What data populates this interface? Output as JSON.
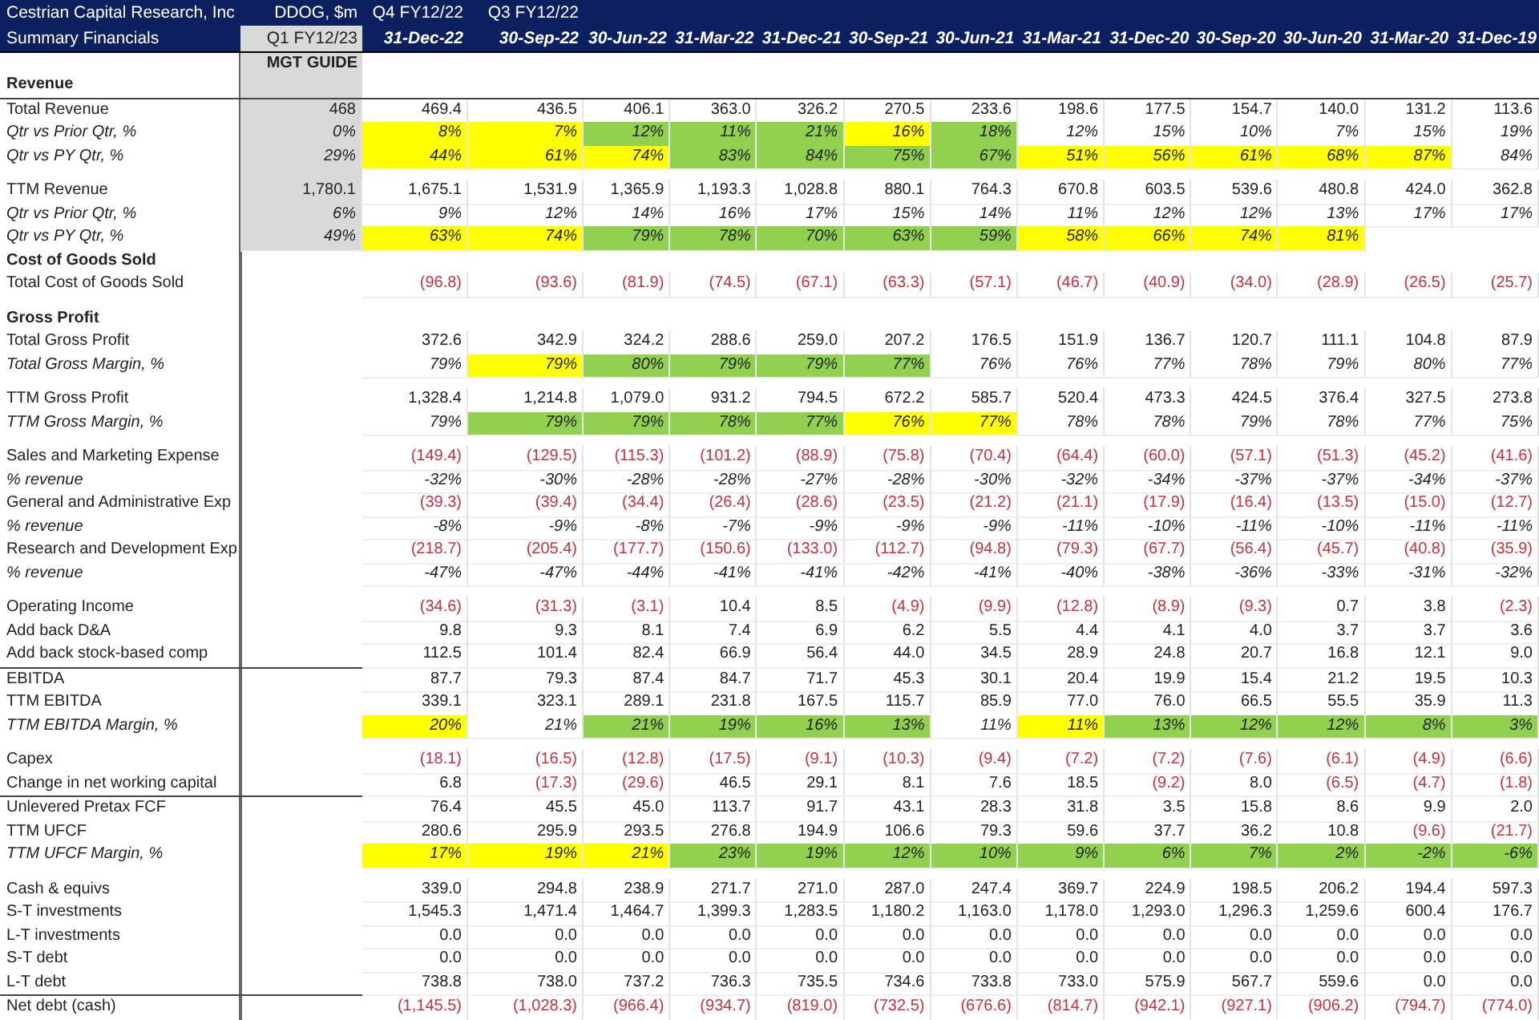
{
  "title": {
    "company": "Cestrian Capital Research, Inc",
    "subtitle": "Summary Financials"
  },
  "columns": [
    {
      "top": "DDOG, $m",
      "bottom": "Q1 FY12/23",
      "note": "MGT GUIDE",
      "shaded": true
    },
    {
      "top": "Q4 FY12/22",
      "bottom": "31-Dec-22",
      "shaded": false
    },
    {
      "top": "Q3 FY12/22",
      "bottom": "30-Sep-22",
      "shaded": false
    },
    {
      "bottom": "30-Jun-22",
      "shaded": false
    },
    {
      "bottom": "31-Mar-22",
      "shaded": false
    },
    {
      "bottom": "31-Dec-21",
      "shaded": false
    },
    {
      "bottom": "30-Sep-21",
      "shaded": false
    },
    {
      "bottom": "30-Jun-21",
      "shaded": false
    },
    {
      "bottom": "31-Mar-21",
      "shaded": false
    },
    {
      "bottom": "31-Dec-20",
      "shaded": false
    },
    {
      "bottom": "30-Sep-20",
      "shaded": false
    },
    {
      "bottom": "30-Jun-20",
      "shaded": false
    },
    {
      "bottom": "31-Mar-20",
      "shaded": false
    },
    {
      "bottom": "31-Dec-19",
      "shaded": false
    }
  ],
  "rows": [
    {
      "kind": "section",
      "label": "Revenue",
      "rule_above": false,
      "guide_shaded": true
    },
    {
      "kind": "value",
      "label": "Total Revenue",
      "rule_above": true,
      "guide_shaded": true,
      "guide": "468",
      "negative": false,
      "cells": [
        "469.4",
        "436.5",
        "406.1",
        "363.0",
        "326.2",
        "270.5",
        "233.6",
        "198.6",
        "177.5",
        "154.7",
        "140.0",
        "131.2",
        "113.6"
      ]
    },
    {
      "kind": "percent",
      "label": "Qtr vs Prior Qtr, %",
      "rule_above": false,
      "guide_shaded": true,
      "guide": "0%",
      "negative": false,
      "cells": [
        {
          "text": "8%",
          "color": "#ffff00"
        },
        {
          "text": "7%",
          "color": "#ffff00"
        },
        {
          "text": "12%",
          "color": "#92d050"
        },
        {
          "text": "11%",
          "color": "#92d050"
        },
        {
          "text": "21%",
          "color": "#92d050"
        },
        {
          "text": "16%",
          "color": "#ffff00"
        },
        {
          "text": "18%",
          "color": "#92d050"
        },
        {
          "text": "12%",
          "color": "#ffffff"
        },
        {
          "text": "15%",
          "color": "#ffffff"
        },
        {
          "text": "10%",
          "color": "#ffffff"
        },
        {
          "text": "7%",
          "color": "#ffffff"
        },
        {
          "text": "15%",
          "color": "#ffffff"
        },
        {
          "text": "19%",
          "color": "#ffffff"
        }
      ]
    },
    {
      "kind": "percent",
      "label": "Qtr vs PY Qtr, %",
      "rule_above": false,
      "guide_shaded": true,
      "guide": "29%",
      "negative": false,
      "cells": [
        {
          "text": "44%",
          "color": "#ffff00"
        },
        {
          "text": "61%",
          "color": "#ffff00"
        },
        {
          "text": "74%",
          "color": "#ffff00"
        },
        {
          "text": "83%",
          "color": "#92d050"
        },
        {
          "text": "84%",
          "color": "#92d050"
        },
        {
          "text": "75%",
          "color": "#92d050"
        },
        {
          "text": "67%",
          "color": "#92d050"
        },
        {
          "text": "51%",
          "color": "#ffff00"
        },
        {
          "text": "56%",
          "color": "#ffff00"
        },
        {
          "text": "61%",
          "color": "#ffff00"
        },
        {
          "text": "68%",
          "color": "#ffff00"
        },
        {
          "text": "87%",
          "color": "#ffff00"
        },
        {
          "text": "84%",
          "color": "#ffffff"
        }
      ]
    },
    {
      "kind": "spacer",
      "rule_above": false,
      "guide_shaded": true
    },
    {
      "kind": "value",
      "label": "TTM Revenue",
      "rule_above": false,
      "guide_shaded": true,
      "guide": "1,780.1",
      "negative": false,
      "cells": [
        "1,675.1",
        "1,531.9",
        "1,365.9",
        "1,193.3",
        "1,028.8",
        "880.1",
        "764.3",
        "670.8",
        "603.5",
        "539.6",
        "480.8",
        "424.0",
        "362.8"
      ]
    },
    {
      "kind": "percent",
      "label": "Qtr vs Prior Qtr, %",
      "rule_above": false,
      "guide_shaded": true,
      "guide": "6%",
      "negative": false,
      "cells": [
        "9%",
        "12%",
        "14%",
        "16%",
        "17%",
        "15%",
        "14%",
        "11%",
        "12%",
        "12%",
        "13%",
        "17%",
        "17%"
      ]
    },
    {
      "kind": "percent",
      "label": "Qtr vs PY Qtr, %",
      "rule_above": false,
      "guide_shaded": true,
      "guide": "49%",
      "negative": false,
      "cells": [
        {
          "text": "63%",
          "color": "#ffff00"
        },
        {
          "text": "74%",
          "color": "#ffff00"
        },
        {
          "text": "79%",
          "color": "#92d050"
        },
        {
          "text": "78%",
          "color": "#92d050"
        },
        {
          "text": "70%",
          "color": "#92d050"
        },
        {
          "text": "63%",
          "color": "#92d050"
        },
        {
          "text": "59%",
          "color": "#92d050"
        },
        {
          "text": "58%",
          "color": "#ffff00"
        },
        {
          "text": "66%",
          "color": "#ffff00"
        },
        {
          "text": "74%",
          "color": "#ffff00"
        },
        {
          "text": "81%",
          "color": "#ffff00"
        }
      ]
    },
    {
      "kind": "section",
      "label": "Cost of Goods Sold",
      "rule_above": false,
      "guide_shaded": false
    },
    {
      "kind": "value",
      "label": "Total Cost of Goods Sold",
      "rule_above": false,
      "guide_shaded": false,
      "negative": true,
      "cells": [
        "(96.8)",
        "(93.6)",
        "(81.9)",
        "(74.5)",
        "(67.1)",
        "(63.3)",
        "(57.1)",
        "(46.7)",
        "(40.9)",
        "(34.0)",
        "(28.9)",
        "(26.5)",
        "(25.7)"
      ]
    },
    {
      "kind": "spacer",
      "rule_above": false,
      "guide_shaded": false
    },
    {
      "kind": "section",
      "label": "Gross Profit",
      "rule_above": false,
      "guide_shaded": false
    },
    {
      "kind": "value",
      "label": "Total Gross Profit",
      "rule_above": false,
      "guide_shaded": false,
      "negative": false,
      "cells": [
        "372.6",
        "342.9",
        "324.2",
        "288.6",
        "259.0",
        "207.2",
        "176.5",
        "151.9",
        "136.7",
        "120.7",
        "111.1",
        "104.8",
        "87.9"
      ]
    },
    {
      "kind": "percent",
      "label": "Total Gross Margin, %",
      "rule_above": false,
      "guide_shaded": false,
      "negative": false,
      "cells": [
        {
          "text": "79%",
          "color": "#ffffff"
        },
        {
          "text": "79%",
          "color": "#ffff00"
        },
        {
          "text": "80%",
          "color": "#92d050"
        },
        {
          "text": "79%",
          "color": "#92d050"
        },
        {
          "text": "79%",
          "color": "#92d050"
        },
        {
          "text": "77%",
          "color": "#92d050"
        },
        {
          "text": "76%",
          "color": "#ffffff"
        },
        {
          "text": "76%",
          "color": "#ffffff"
        },
        {
          "text": "77%",
          "color": "#ffffff"
        },
        {
          "text": "78%",
          "color": "#ffffff"
        },
        {
          "text": "79%",
          "color": "#ffffff"
        },
        {
          "text": "80%",
          "color": "#ffffff"
        },
        {
          "text": "77%",
          "color": "#ffffff"
        }
      ]
    },
    {
      "kind": "spacer",
      "rule_above": false,
      "guide_shaded": false
    },
    {
      "kind": "value",
      "label": "TTM Gross Profit",
      "rule_above": false,
      "guide_shaded": false,
      "negative": false,
      "cells": [
        "1,328.4",
        "1,214.8",
        "1,079.0",
        "931.2",
        "794.5",
        "672.2",
        "585.7",
        "520.4",
        "473.3",
        "424.5",
        "376.4",
        "327.5",
        "273.8"
      ]
    },
    {
      "kind": "percent",
      "label": "TTM Gross Margin, %",
      "rule_above": false,
      "guide_shaded": false,
      "negative": false,
      "cells": [
        {
          "text": "79%",
          "color": "#ffffff"
        },
        {
          "text": "79%",
          "color": "#92d050"
        },
        {
          "text": "79%",
          "color": "#92d050"
        },
        {
          "text": "78%",
          "color": "#92d050"
        },
        {
          "text": "77%",
          "color": "#92d050"
        },
        {
          "text": "76%",
          "color": "#ffff00"
        },
        {
          "text": "77%",
          "color": "#ffff00"
        },
        {
          "text": "78%",
          "color": "#ffffff"
        },
        {
          "text": "78%",
          "color": "#ffffff"
        },
        {
          "text": "79%",
          "color": "#ffffff"
        },
        {
          "text": "78%",
          "color": "#ffffff"
        },
        {
          "text": "77%",
          "color": "#ffffff"
        },
        {
          "text": "75%",
          "color": "#ffffff"
        }
      ]
    },
    {
      "kind": "spacer",
      "rule_above": false,
      "guide_shaded": false
    },
    {
      "kind": "value",
      "label": "Sales and Marketing Expense",
      "rule_above": false,
      "guide_shaded": false,
      "negative": true,
      "cells": [
        "(149.4)",
        "(129.5)",
        "(115.3)",
        "(101.2)",
        "(88.9)",
        "(75.8)",
        "(70.4)",
        "(64.4)",
        "(60.0)",
        "(57.1)",
        "(51.3)",
        "(45.2)",
        "(41.6)"
      ]
    },
    {
      "kind": "percent",
      "label": "% revenue",
      "rule_above": false,
      "guide_shaded": false,
      "negative": false,
      "cells": [
        "-32%",
        "-30%",
        "-28%",
        "-28%",
        "-27%",
        "-28%",
        "-30%",
        "-32%",
        "-34%",
        "-37%",
        "-37%",
        "-34%",
        "-37%"
      ]
    },
    {
      "kind": "value",
      "label": "General and Administrative Exp",
      "rule_above": false,
      "guide_shaded": false,
      "negative": true,
      "cells": [
        "(39.3)",
        "(39.4)",
        "(34.4)",
        "(26.4)",
        "(28.6)",
        "(23.5)",
        "(21.2)",
        "(21.1)",
        "(17.9)",
        "(16.4)",
        "(13.5)",
        "(15.0)",
        "(12.7)"
      ]
    },
    {
      "kind": "percent",
      "label": "% revenue",
      "rule_above": false,
      "guide_shaded": false,
      "negative": false,
      "cells": [
        "-8%",
        "-9%",
        "-8%",
        "-7%",
        "-9%",
        "-9%",
        "-9%",
        "-11%",
        "-10%",
        "-11%",
        "-10%",
        "-11%",
        "-11%"
      ]
    },
    {
      "kind": "value",
      "label": "Research and Development Exp",
      "rule_above": false,
      "guide_shaded": false,
      "negative": true,
      "cells": [
        "(218.7)",
        "(205.4)",
        "(177.7)",
        "(150.6)",
        "(133.0)",
        "(112.7)",
        "(94.8)",
        "(79.3)",
        "(67.7)",
        "(56.4)",
        "(45.7)",
        "(40.8)",
        "(35.9)"
      ]
    },
    {
      "kind": "percent",
      "label": "% revenue",
      "rule_above": false,
      "guide_shaded": false,
      "negative": false,
      "cells": [
        "-47%",
        "-47%",
        "-44%",
        "-41%",
        "-41%",
        "-42%",
        "-41%",
        "-40%",
        "-38%",
        "-36%",
        "-33%",
        "-31%",
        "-32%"
      ]
    },
    {
      "kind": "spacer",
      "rule_above": false,
      "guide_shaded": false
    },
    {
      "kind": "value",
      "label": "Operating Income",
      "rule_above": false,
      "guide_shaded": false,
      "cells": [
        {
          "text": "(34.6)",
          "negative": true
        },
        {
          "text": "(31.3)",
          "negative": true
        },
        {
          "text": "(3.1)",
          "negative": true
        },
        {
          "text": "10.4",
          "negative": false
        },
        {
          "text": "8.5",
          "negative": false
        },
        {
          "text": "(4.9)",
          "negative": true
        },
        {
          "text": "(9.9)",
          "negative": true
        },
        {
          "text": "(12.8)",
          "negative": true
        },
        {
          "text": "(8.9)",
          "negative": true
        },
        {
          "text": "(9.3)",
          "negative": true
        },
        {
          "text": "0.7",
          "negative": false
        },
        {
          "text": "3.8",
          "negative": false
        },
        {
          "text": "(2.3)",
          "negative": true
        }
      ]
    },
    {
      "kind": "value",
      "label": "Add back D&A",
      "rule_above": false,
      "guide_shaded": false,
      "negative": false,
      "cells": [
        "9.8",
        "9.3",
        "8.1",
        "7.4",
        "6.9",
        "6.2",
        "5.5",
        "4.4",
        "4.1",
        "4.0",
        "3.7",
        "3.7",
        "3.6"
      ]
    },
    {
      "kind": "value",
      "label": "Add back stock-based comp",
      "rule_above": false,
      "guide_shaded": false,
      "negative": false,
      "cells": [
        "112.5",
        "101.4",
        "82.4",
        "66.9",
        "56.4",
        "44.0",
        "34.5",
        "28.9",
        "24.8",
        "20.7",
        "16.8",
        "12.1",
        "9.0"
      ]
    },
    {
      "kind": "value",
      "label": "EBITDA",
      "rule_above": true,
      "guide_shaded": false,
      "negative": false,
      "cells": [
        "87.7",
        "79.3",
        "87.4",
        "84.7",
        "71.7",
        "45.3",
        "30.1",
        "20.4",
        "19.9",
        "15.4",
        "21.2",
        "19.5",
        "10.3"
      ]
    },
    {
      "kind": "value",
      "label": "TTM EBITDA",
      "rule_above": false,
      "guide_shaded": false,
      "negative": false,
      "cells": [
        "339.1",
        "323.1",
        "289.1",
        "231.8",
        "167.5",
        "115.7",
        "85.9",
        "77.0",
        "76.0",
        "66.5",
        "55.5",
        "35.9",
        "11.3"
      ]
    },
    {
      "kind": "percent",
      "label": "TTM EBITDA Margin, %",
      "rule_above": false,
      "guide_shaded": false,
      "negative": false,
      "cells": [
        {
          "text": "20%",
          "color": "#ffff00"
        },
        {
          "text": "21%",
          "color": "#ffffff"
        },
        {
          "text": "21%",
          "color": "#92d050"
        },
        {
          "text": "19%",
          "color": "#92d050"
        },
        {
          "text": "16%",
          "color": "#92d050"
        },
        {
          "text": "13%",
          "color": "#92d050"
        },
        {
          "text": "11%",
          "color": "#ffffff"
        },
        {
          "text": "11%",
          "color": "#ffff00"
        },
        {
          "text": "13%",
          "color": "#92d050"
        },
        {
          "text": "12%",
          "color": "#92d050"
        },
        {
          "text": "12%",
          "color": "#92d050"
        },
        {
          "text": "8%",
          "color": "#92d050"
        },
        {
          "text": "3%",
          "color": "#92d050"
        }
      ]
    },
    {
      "kind": "spacer",
      "rule_above": false,
      "guide_shaded": false
    },
    {
      "kind": "value",
      "label": "Capex",
      "rule_above": false,
      "guide_shaded": false,
      "negative": true,
      "cells": [
        "(18.1)",
        "(16.5)",
        "(12.8)",
        "(17.5)",
        "(9.1)",
        "(10.3)",
        "(9.4)",
        "(7.2)",
        "(7.2)",
        "(7.6)",
        "(6.1)",
        "(4.9)",
        "(6.6)"
      ]
    },
    {
      "kind": "value",
      "label": "Change in net working capital",
      "rule_above": false,
      "guide_shaded": false,
      "cells": [
        {
          "text": "6.8",
          "negative": false
        },
        {
          "text": "(17.3)",
          "negative": true
        },
        {
          "text": "(29.6)",
          "negative": true
        },
        {
          "text": "46.5",
          "negative": false
        },
        {
          "text": "29.1",
          "negative": false
        },
        {
          "text": "8.1",
          "negative": false
        },
        {
          "text": "7.6",
          "negative": false
        },
        {
          "text": "18.5",
          "negative": false
        },
        {
          "text": "(9.2)",
          "negative": true
        },
        {
          "text": "8.0",
          "negative": false
        },
        {
          "text": "(6.5)",
          "negative": true
        },
        {
          "text": "(4.7)",
          "negative": true
        },
        {
          "text": "(1.8)",
          "negative": true
        }
      ]
    },
    {
      "kind": "value",
      "label": "Unlevered Pretax FCF",
      "rule_above": true,
      "guide_shaded": false,
      "negative": false,
      "cells": [
        "76.4",
        "45.5",
        "45.0",
        "113.7",
        "91.7",
        "43.1",
        "28.3",
        "31.8",
        "3.5",
        "15.8",
        "8.6",
        "9.9",
        "2.0"
      ]
    },
    {
      "kind": "value",
      "label": "TTM UFCF",
      "rule_above": false,
      "guide_shaded": false,
      "cells": [
        {
          "text": "280.6",
          "negative": false
        },
        {
          "text": "295.9",
          "negative": false
        },
        {
          "text": "293.5",
          "negative": false
        },
        {
          "text": "276.8",
          "negative": false
        },
        {
          "text": "194.9",
          "negative": false
        },
        {
          "text": "106.6",
          "negative": false
        },
        {
          "text": "79.3",
          "negative": false
        },
        {
          "text": "59.6",
          "negative": false
        },
        {
          "text": "37.7",
          "negative": false
        },
        {
          "text": "36.2",
          "negative": false
        },
        {
          "text": "10.8",
          "negative": false
        },
        {
          "text": "(9.6)",
          "negative": true
        },
        {
          "text": "(21.7)",
          "negative": true
        }
      ]
    },
    {
      "kind": "percent",
      "label": "TTM UFCF Margin, %",
      "rule_above": false,
      "guide_shaded": false,
      "negative": false,
      "cells": [
        {
          "text": "17%",
          "color": "#ffff00"
        },
        {
          "text": "19%",
          "color": "#ffff00"
        },
        {
          "text": "21%",
          "color": "#ffff00"
        },
        {
          "text": "23%",
          "color": "#92d050"
        },
        {
          "text": "19%",
          "color": "#92d050"
        },
        {
          "text": "12%",
          "color": "#92d050"
        },
        {
          "text": "10%",
          "color": "#92d050"
        },
        {
          "text": "9%",
          "color": "#92d050"
        },
        {
          "text": "6%",
          "color": "#92d050"
        },
        {
          "text": "7%",
          "color": "#92d050"
        },
        {
          "text": "2%",
          "color": "#92d050"
        },
        {
          "text": "-2%",
          "color": "#92d050"
        },
        {
          "text": "-6%",
          "color": "#92d050"
        }
      ]
    },
    {
      "kind": "spacer",
      "rule_above": false,
      "guide_shaded": false
    },
    {
      "kind": "value",
      "label": "Cash & equivs",
      "rule_above": false,
      "guide_shaded": false,
      "negative": false,
      "cells": [
        "339.0",
        "294.8",
        "238.9",
        "271.7",
        "271.0",
        "287.0",
        "247.4",
        "369.7",
        "224.9",
        "198.5",
        "206.2",
        "194.4",
        "597.3"
      ]
    },
    {
      "kind": "value",
      "label": "S-T investments",
      "rule_above": false,
      "guide_shaded": false,
      "negative": false,
      "cells": [
        "1,545.3",
        "1,471.4",
        "1,464.7",
        "1,399.3",
        "1,283.5",
        "1,180.2",
        "1,163.0",
        "1,178.0",
        "1,293.0",
        "1,296.3",
        "1,259.6",
        "600.4",
        "176.7"
      ]
    },
    {
      "kind": "value",
      "label": "L-T investments",
      "rule_above": false,
      "guide_shaded": false,
      "negative": false,
      "cells": [
        "0.0",
        "0.0",
        "0.0",
        "0.0",
        "0.0",
        "0.0",
        "0.0",
        "0.0",
        "0.0",
        "0.0",
        "0.0",
        "0.0",
        "0.0"
      ]
    },
    {
      "kind": "value",
      "label": "S-T debt",
      "rule_above": false,
      "guide_shaded": false,
      "negative": false,
      "cells": [
        "0.0",
        "0.0",
        "0.0",
        "0.0",
        "0.0",
        "0.0",
        "0.0",
        "0.0",
        "0.0",
        "0.0",
        "0.0",
        "0.0",
        "0.0"
      ]
    },
    {
      "kind": "value",
      "label": "L-T debt",
      "rule_above": false,
      "guide_shaded": false,
      "negative": false,
      "cells": [
        "738.8",
        "738.0",
        "737.2",
        "736.3",
        "735.5",
        "734.6",
        "733.8",
        "733.0",
        "575.9",
        "567.7",
        "559.6",
        "0.0",
        "0.0"
      ]
    },
    {
      "kind": "value",
      "label": "Net debt (cash)",
      "rule_above": true,
      "guide_shaded": false,
      "negative": true,
      "cells": [
        "(1,145.5)",
        "(1,028.3)",
        "(966.4)",
        "(934.7)",
        "(819.0)",
        "(732.5)",
        "(676.6)",
        "(814.7)",
        "(942.1)",
        "(927.1)",
        "(906.2)",
        "(794.7)",
        "(774.0)"
      ]
    }
  ]
}
